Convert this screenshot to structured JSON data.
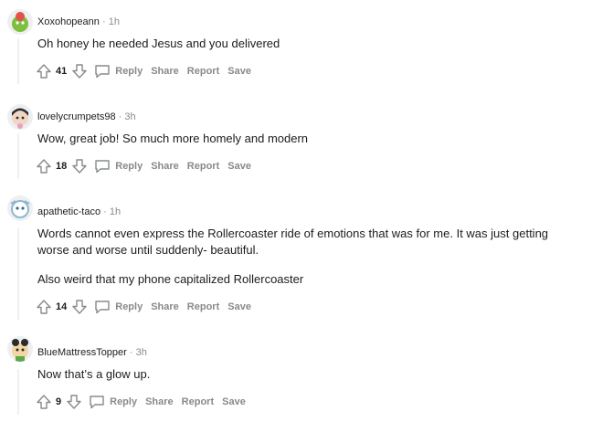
{
  "comments": [
    {
      "author": "Xoxohopeann",
      "time": "1h",
      "body": [
        "Oh honey he needed Jesus and you delivered"
      ],
      "score": "41",
      "avatar_color": "#7fbf3f"
    },
    {
      "author": "lovelycrumpets98",
      "time": "3h",
      "body": [
        "Wow, great job! So much more homely and modern"
      ],
      "score": "18",
      "avatar_color": "#e8a0c0"
    },
    {
      "author": "apathetic-taco",
      "time": "1h",
      "body": [
        "Words cannot even express the Rollercoaster ride of emotions that was for me. It was just getting worse and worse until suddenly- beautiful.",
        "Also weird that my phone capitalized Rollercoaster"
      ],
      "score": "14",
      "avatar_color": "#8fb7d0"
    },
    {
      "author": "BlueMattressTopper",
      "time": "3h",
      "body": [
        "Now that’s a glow up."
      ],
      "score": "9",
      "avatar_color": "#5aa84a"
    }
  ],
  "actions": {
    "reply": "Reply",
    "share": "Share",
    "report": "Report",
    "save": "Save"
  },
  "separator": "·",
  "icons": {
    "upvote": "upvote-arrow-icon",
    "downvote": "downvote-arrow-icon",
    "reply": "speech-bubble-icon"
  }
}
